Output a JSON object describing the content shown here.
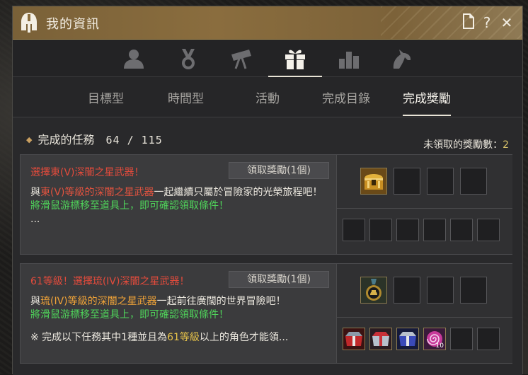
{
  "window": {
    "title": "我的資訊",
    "controls": [
      "page-icon",
      "help",
      "close"
    ],
    "help_label": "?",
    "close_label": "✕"
  },
  "top_tabs": [
    {
      "icon": "profile-icon",
      "active": false
    },
    {
      "icon": "medal-icon",
      "active": false
    },
    {
      "icon": "telescope-icon",
      "active": false
    },
    {
      "icon": "gift-icon",
      "active": true
    },
    {
      "icon": "bar-chart-icon",
      "active": false
    },
    {
      "icon": "horse-icon",
      "active": false
    }
  ],
  "sub_tabs": [
    {
      "label": "目標型",
      "active": false
    },
    {
      "label": "時間型",
      "active": false
    },
    {
      "label": "活動",
      "active": false
    },
    {
      "label": "完成目錄",
      "active": false
    },
    {
      "label": "完成獎勵",
      "active": true
    }
  ],
  "summary": {
    "label": "完成的任務",
    "count": "64 / 115",
    "unclaimed_label": "未領取的獎勵數：",
    "unclaimed_count": "2"
  },
  "quests": [
    {
      "title": "選擇東(V)深闇之星武器！",
      "claim_label": "領取獎勵(1個)",
      "desc_pre": "與",
      "desc_hl": "東(V)等級的深闇之星武器",
      "desc_post": "一起繼續只屬於冒險家的光榮旅程吧！",
      "hint": "將滑鼠游標移至道具上，即可確認領取條件！",
      "extra": "...",
      "main_rewards": [
        "treasure-chest-icon",
        "",
        "",
        ""
      ],
      "sub_rewards": [
        "",
        "",
        "",
        "",
        "",
        ""
      ]
    },
    {
      "title": "61等級！選擇琉(IV)深闇之星武器！",
      "claim_label": "領取獎勵(1個)",
      "desc_pre": "與",
      "desc_hl": "琉(IV)等級的深闇之星武器",
      "desc_post": "一起前往廣闊的世界冒險吧！",
      "hint": "將滑鼠游標移至道具上，即可確認領取條件！",
      "note_pre": "※ 完成以下任務其中1種並且為",
      "note_hl": "61等級",
      "note_post": "以上的角色才能領...",
      "main_rewards": [
        "medal-badge-icon",
        "",
        "",
        ""
      ],
      "sub_rewards": [
        {
          "icon": "red-box-icon",
          "qty": ""
        },
        {
          "icon": "silver-red-box-icon",
          "qty": ""
        },
        {
          "icon": "blue-box-icon",
          "qty": ""
        },
        {
          "icon": "spiral-scroll-icon",
          "qty": "10"
        },
        {
          "icon": "",
          "qty": ""
        },
        {
          "icon": "",
          "qty": ""
        }
      ]
    }
  ],
  "colors": {
    "title_bar": "#8a6d3e",
    "quest_title": "#e34b3c",
    "highlight_red": "#e2533f",
    "hint_green": "#4fd35a",
    "level_gold": "#e7c34a"
  }
}
